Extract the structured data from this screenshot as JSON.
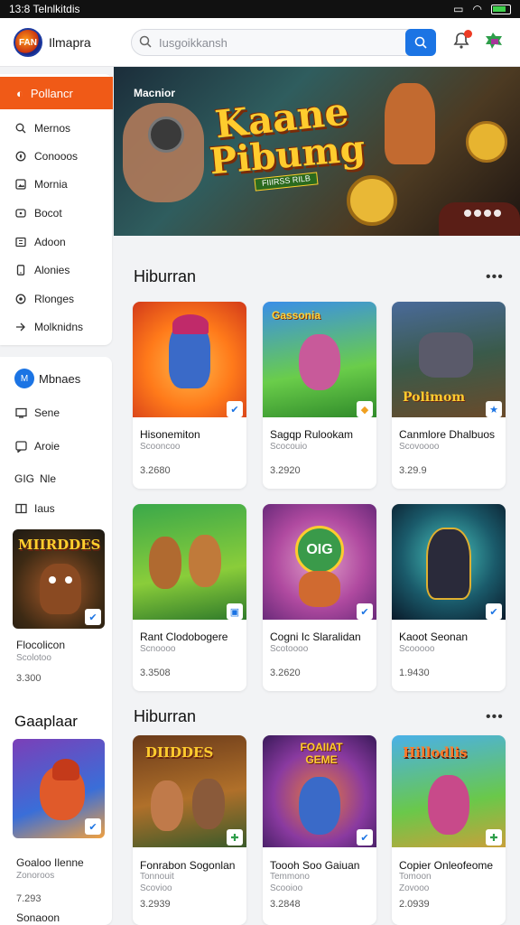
{
  "status_bar": {
    "time": "13:8 Telnlkitdis"
  },
  "header": {
    "app_name": "Ilmapra",
    "logo_text": "FAN",
    "search_placeholder": "Iusgoikkansh"
  },
  "sidebar": {
    "active_label": "Pollancr",
    "items": [
      {
        "label": "Mernos",
        "icon": "search-icon"
      },
      {
        "label": "Conooos",
        "icon": "compass-icon"
      },
      {
        "label": "Mornia",
        "icon": "image-icon"
      },
      {
        "label": "Bocot",
        "icon": "gamepad-icon"
      },
      {
        "label": "Adoon",
        "icon": "grid-icon"
      },
      {
        "label": "Alonies",
        "icon": "phone-icon"
      },
      {
        "label": "Rlonges",
        "icon": "target-icon"
      },
      {
        "label": "Molknidns",
        "icon": "arrow-icon"
      }
    ],
    "user": {
      "avatar": "M",
      "name": "Mbnaes"
    },
    "links": [
      {
        "label": "Sene",
        "icon": "monitor-icon"
      },
      {
        "label": "Aroie",
        "icon": "chat-icon"
      },
      {
        "label": "Nle",
        "prefix": "GIG"
      },
      {
        "label": "Iaus",
        "icon": "book-icon"
      }
    ],
    "featured": {
      "title": "Flocolicon",
      "sub": "Scolotoo",
      "price": "3.300",
      "art_text": "MIIRDDES"
    },
    "heading": "Gaaplaar",
    "featured2": {
      "title": "Goaloo Ilenne",
      "sub": "Zonoroos",
      "price": "7.293",
      "extra": "Sonaoon"
    }
  },
  "banner": {
    "label": "Macnior",
    "title_line1": "Kaane",
    "title_line2": "Pibumg",
    "subtitle": "FIIIRSS RILB",
    "dots": 4
  },
  "sections": [
    {
      "title": "Hiburran",
      "more": "•••",
      "cards": [
        {
          "title": "Hisonemiton",
          "sub": "Scooncoo",
          "price": "3.2680",
          "art": ""
        },
        {
          "title": "Sagqp Rulookam",
          "sub": "Scocouio",
          "price": "3.2920",
          "art": "Gassonia"
        },
        {
          "title": "Canmlore Dhalbuos",
          "sub": "Scovoooo",
          "price": "3.29.9",
          "art": "Polimom"
        },
        {
          "title": "Rant Clodobogere",
          "sub": "Scnoooo",
          "price": "3.3508",
          "art": ""
        },
        {
          "title": "Cogni Ic Slaralidan",
          "sub": "Scotoooo",
          "price": "3.2620",
          "art": "OIG"
        },
        {
          "title": "Kaoot Seonan",
          "sub": "Scooooo",
          "price": "1.9430",
          "art": ""
        }
      ]
    },
    {
      "title": "Hiburran",
      "more": "•••",
      "cards": [
        {
          "title": "Fonrabon Sogonlan",
          "sub": "Tonnouit",
          "sub2": "Scovioo",
          "price": "3.2939",
          "art": "DIIDDES"
        },
        {
          "title": "Toooh Soo Gaiuan",
          "sub": "Temmono",
          "sub2": "Scooioo",
          "price": "3.2848",
          "art": "FOAIIAT GEME"
        },
        {
          "title": "Copier Onleofeome",
          "sub": "Tomoon",
          "sub2": "Zovooo",
          "price": "2.0939",
          "art": "Hillodlis"
        }
      ]
    }
  ],
  "colors": {
    "accent": "#f05a17",
    "primary": "#1b74e4"
  }
}
